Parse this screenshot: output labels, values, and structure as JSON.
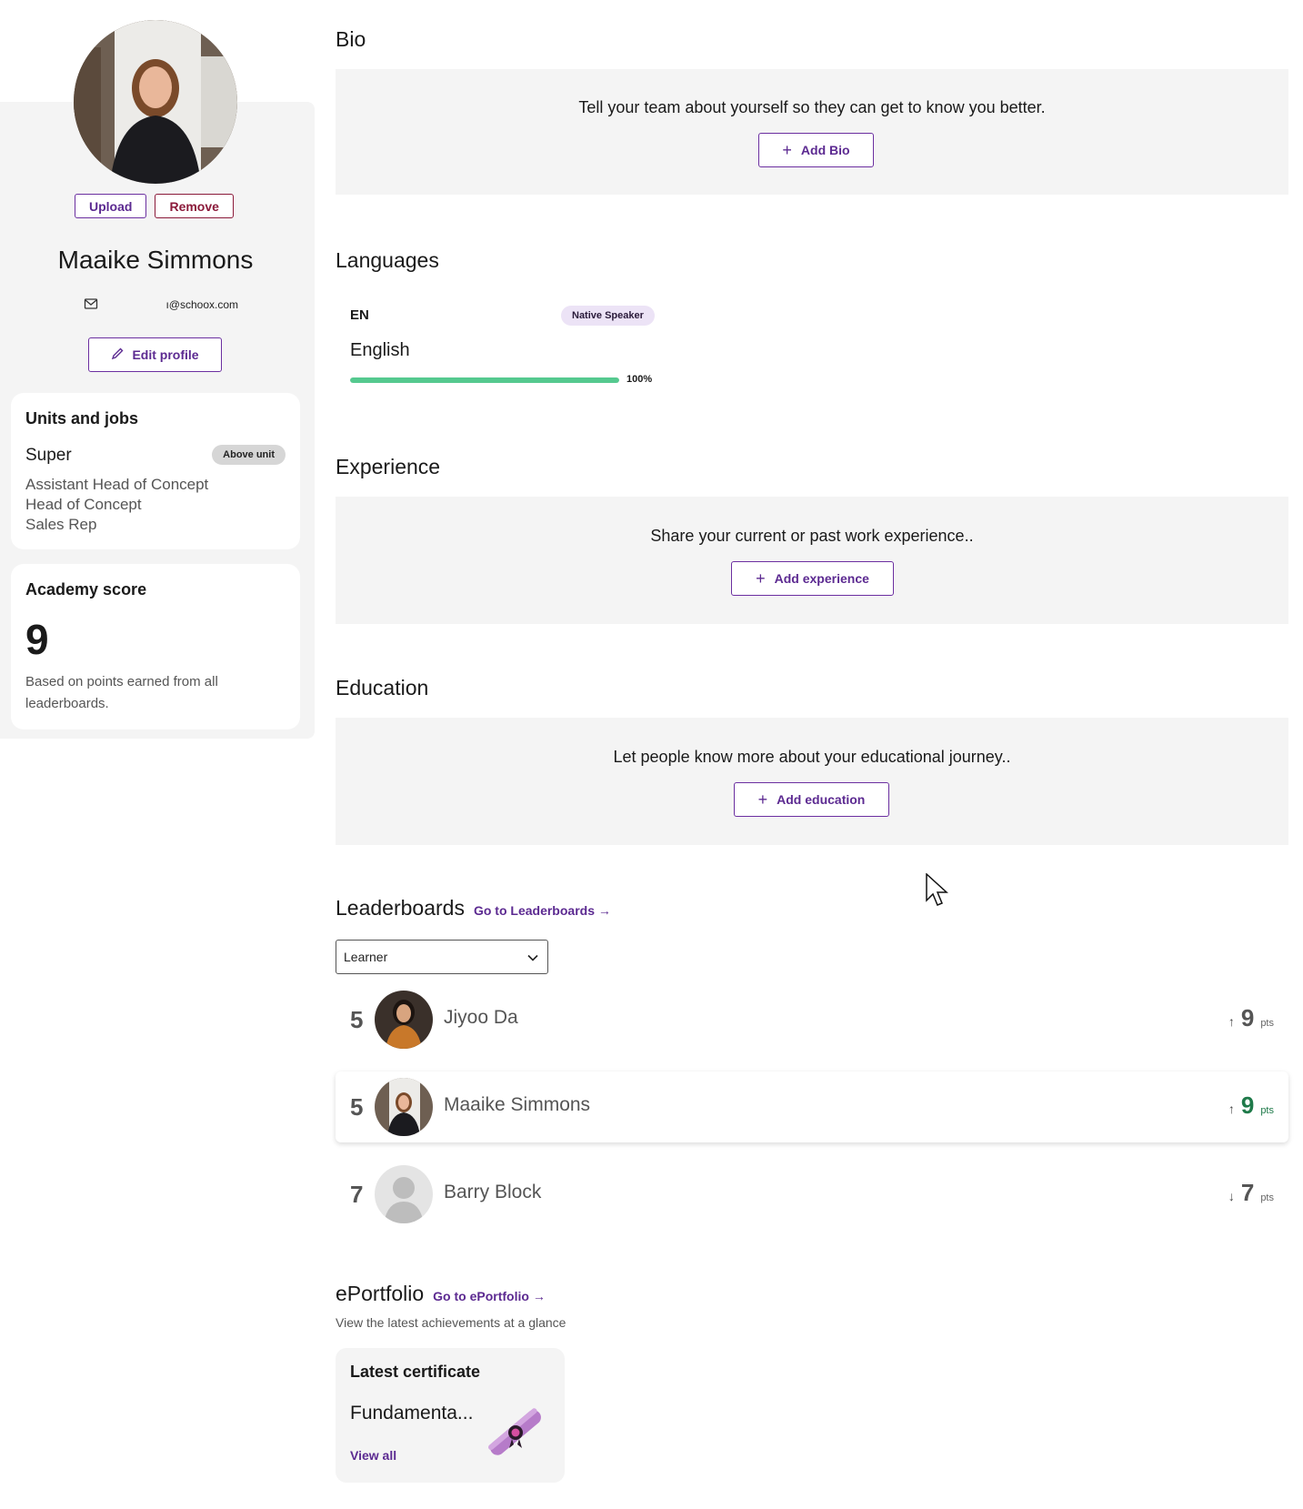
{
  "profile": {
    "upload_label": "Upload",
    "remove_label": "Remove",
    "name": "Maaike Simmons",
    "email": "ı@schoox.com",
    "edit_label": "Edit profile"
  },
  "units_card": {
    "title": "Units and jobs",
    "unit": "Super",
    "unit_badge": "Above unit",
    "jobs": [
      "Assistant Head of Concept",
      "Head of Concept",
      "Sales Rep"
    ]
  },
  "academy_card": {
    "title": "Academy score",
    "score": "9",
    "description": "Based on points earned from all leaderboards."
  },
  "bio": {
    "title": "Bio",
    "prompt": "Tell your team about yourself so they can get to know you better.",
    "button_label": "Add Bio"
  },
  "languages": {
    "title": "Languages",
    "items": [
      {
        "code": "EN",
        "badge": "Native Speaker",
        "name": "English",
        "proficiency": 1.0,
        "percent_label": "100%"
      }
    ]
  },
  "experience": {
    "title": "Experience",
    "prompt": "Share your current or past work experience..",
    "button_label": "Add experience"
  },
  "education": {
    "title": "Education",
    "prompt": "Let people know more about your educational journey..",
    "button_label": "Add education"
  },
  "leaderboards": {
    "title": "Leaderboards",
    "link_label": "Go to Leaderboards",
    "filter_value": "Learner",
    "rows": [
      {
        "rank": "5",
        "name": "Jiyoo Da",
        "trend": "up",
        "points": "9",
        "unit": "pts"
      },
      {
        "rank": "5",
        "name": "Maaike Simmons",
        "trend": "up",
        "points": "9",
        "unit": "pts"
      },
      {
        "rank": "7",
        "name": "Barry Block",
        "trend": "down",
        "points": "7",
        "unit": "pts"
      }
    ]
  },
  "eportfolio": {
    "title": "ePortfolio",
    "link_label": "Go to ePortfolio",
    "subtitle": "View the latest achievements at a glance",
    "card_title": "Latest certificate",
    "certificate_name": "Fundamenta...",
    "view_all_label": "View all"
  },
  "colors": {
    "accent": "#5c2a91",
    "remove": "#8b1a3a",
    "progress": "#55c98f",
    "panel_bg": "#f4f4f4",
    "positive": "#1f7a4a"
  }
}
